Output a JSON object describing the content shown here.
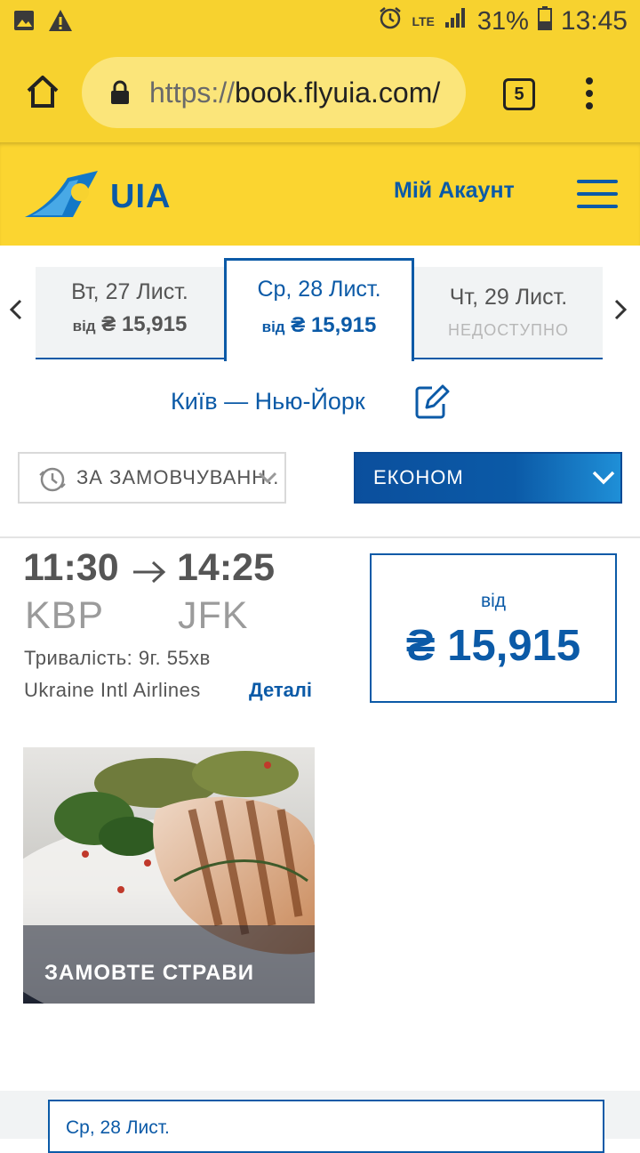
{
  "status_bar": {
    "battery_pct": "31%",
    "time": "13:45",
    "network": "LTE"
  },
  "browser": {
    "url_protocol": "https://",
    "url_host": "book.flyuia.com/",
    "tab_count": "5"
  },
  "header": {
    "logo_text": "UIA",
    "account_label": "Мій Акаунт"
  },
  "date_tabs": [
    {
      "day": "Вт, 27 Лист.",
      "from": "від",
      "price": "₴ 15,915"
    },
    {
      "day": "Ср, 28 Лист.",
      "from": "від",
      "price": "₴ 15,915"
    },
    {
      "day": "Чт, 29 Лист.",
      "status": "НЕДОСТУПНО"
    }
  ],
  "route": "Київ — Нью-Йорк",
  "filters": {
    "sort_label": "ЗА ЗАМОВЧУВАНН...",
    "class_label": "ЕКОНОМ"
  },
  "flight": {
    "depart_time": "11:30",
    "arrive_time": "14:25",
    "origin": "KBP",
    "destination": "JFK",
    "duration": "Тривалість: 9г. 55хв",
    "airline": "Ukraine Intl Airlines",
    "details_label": "Деталі",
    "price_from": "від",
    "price": "₴ 15,915"
  },
  "promo": {
    "caption": "ЗАМОВТЕ СТРАВИ"
  },
  "bottom_card": {
    "date": "Ср, 28 Лист."
  },
  "colors": {
    "brand_yellow": "#f7d22f",
    "brand_blue": "#0b5aa7"
  },
  "icons": [
    "gallery-icon",
    "warning-icon",
    "alarm-icon",
    "signal-icon",
    "battery-icon",
    "home-icon",
    "lock-icon",
    "tabs-icon",
    "more-vert-icon",
    "uia-logo-icon",
    "menu-icon",
    "chevron-left-icon",
    "chevron-right-icon",
    "edit-icon",
    "clock-icon",
    "chevron-down-icon"
  ]
}
